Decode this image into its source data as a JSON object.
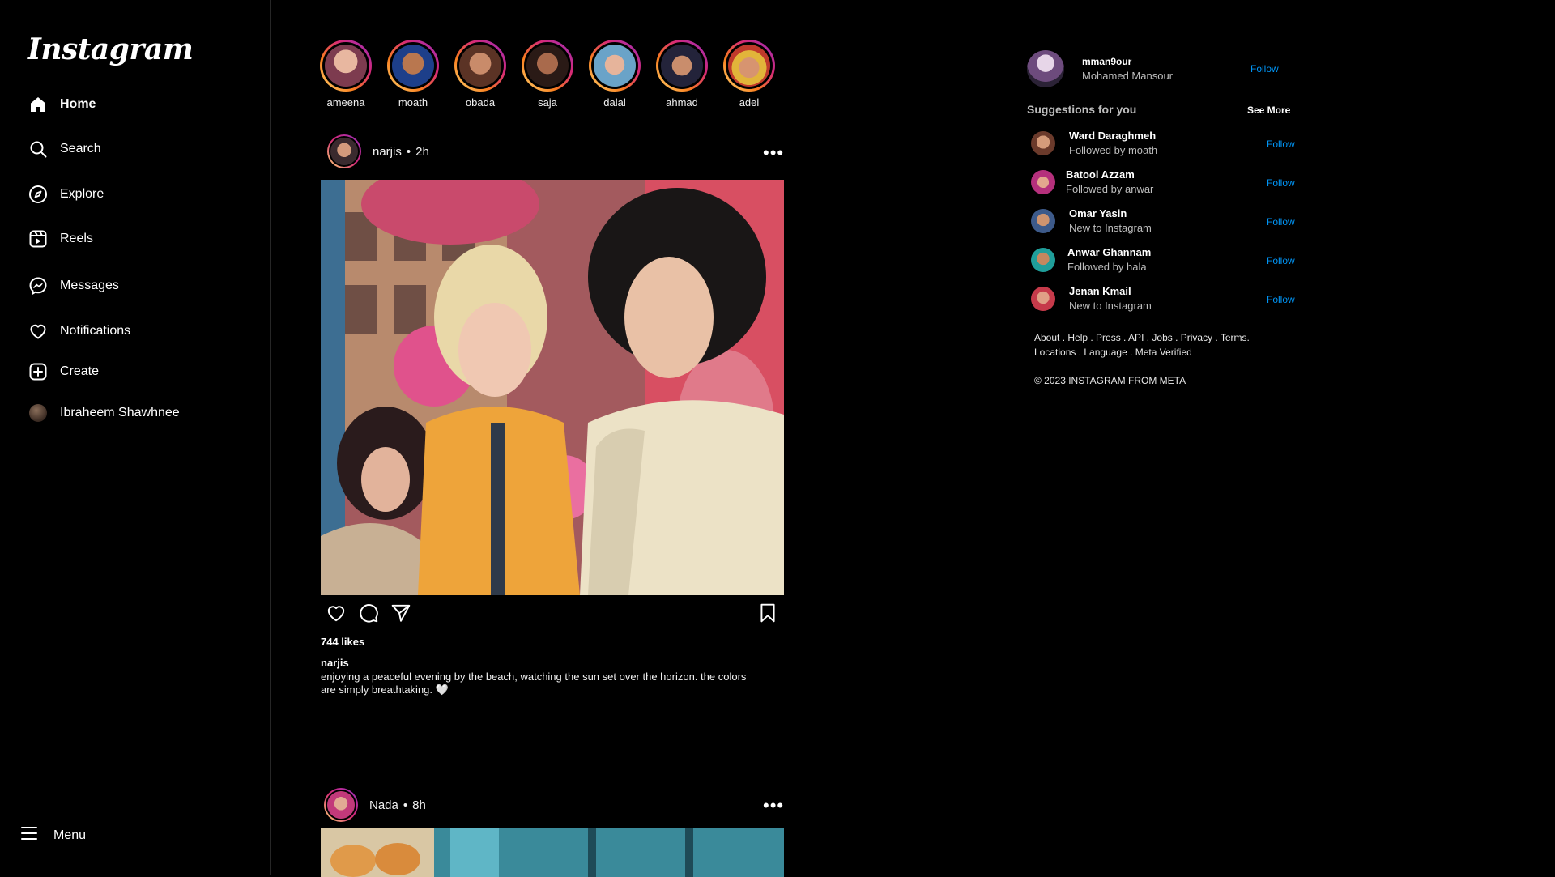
{
  "app": {
    "logo": "Instagram"
  },
  "sidebar": {
    "items": [
      {
        "label": "Home",
        "icon": "home-icon"
      },
      {
        "label": "Search",
        "icon": "search-icon"
      },
      {
        "label": "Explore",
        "icon": "compass-icon"
      },
      {
        "label": "Reels",
        "icon": "reels-icon"
      },
      {
        "label": "Messages",
        "icon": "messenger-icon"
      },
      {
        "label": "Notifications",
        "icon": "heart-icon"
      },
      {
        "label": "Create",
        "icon": "plus-square-icon"
      },
      {
        "label": "Ibraheem Shawhnee",
        "icon": "profile-avatar"
      }
    ],
    "menu_label": "Menu"
  },
  "stories": [
    {
      "name": "ameena"
    },
    {
      "name": "moath"
    },
    {
      "name": "obada"
    },
    {
      "name": "saja"
    },
    {
      "name": "dalal"
    },
    {
      "name": "ahmad"
    },
    {
      "name": "adel"
    }
  ],
  "posts": [
    {
      "user": "narjis",
      "time": "2h",
      "likes": "744 likes",
      "caption_user": "narjis",
      "caption": "enjoying a peaceful evening by the beach, watching the sun set over the horizon. the colors are simply breathtaking. 🤍"
    },
    {
      "user": "Nada",
      "time": "8h"
    }
  ],
  "right": {
    "me": {
      "username": "mman9our",
      "fullname": "Mohamed Mansour",
      "follow": "Follow"
    },
    "suggestions_title": "Suggestions for you",
    "see_more": "See More",
    "suggestions": [
      {
        "name": "Ward Daraghmeh",
        "sub": "Followed by moath",
        "follow": "Follow"
      },
      {
        "name": "Batool Azzam",
        "sub": "Followed by anwar",
        "follow": "Follow"
      },
      {
        "name": "Omar Yasin",
        "sub": "New to Instagram",
        "follow": "Follow"
      },
      {
        "name": "Anwar Ghannam",
        "sub": "Followed by hala",
        "follow": "Follow"
      },
      {
        "name": "Jenan Kmail",
        "sub": "New to Instagram",
        "follow": "Follow"
      }
    ],
    "footer_line1": "About . Help . Press . API . Jobs . Privacy . Terms.",
    "footer_line2": "Locations . Language . Meta Verified",
    "copyright": "© 2023 INSTAGRAM FROM META"
  }
}
